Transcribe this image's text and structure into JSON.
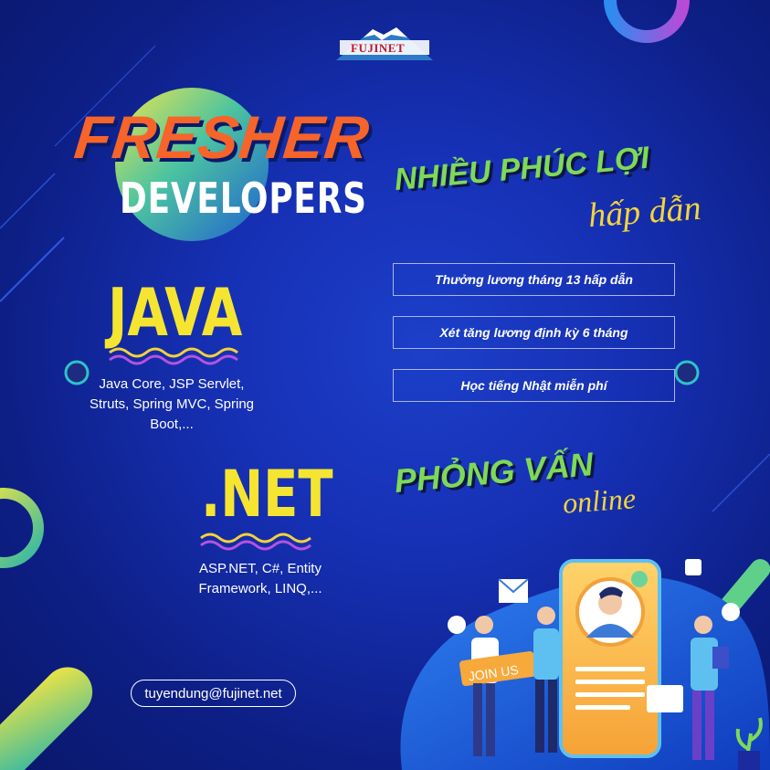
{
  "logo": {
    "text": "FUJINET"
  },
  "headline": {
    "line1": "FRESHER",
    "line2": "DEVELOPERS"
  },
  "java": {
    "title": "JAVA",
    "description": "Java Core, JSP Servlet, Struts, Spring MVC, Spring Boot,..."
  },
  "dotnet": {
    "title": ".NET",
    "description": "ASP.NET, C#, Entity Framework, LINQ,..."
  },
  "benefits": {
    "heading": "NHIỀU PHÚC LỢI",
    "subheading": "hấp dẫn",
    "items": [
      "Thưởng lương tháng 13 hấp dẫn",
      "Xét  tăng lương định kỳ 6 tháng",
      "Học tiếng Nhật miễn phí"
    ]
  },
  "interview": {
    "heading": "PHỎNG VẤN",
    "subheading": "online"
  },
  "illustration": {
    "sign": "JOIN US"
  },
  "contact": {
    "email": "tuyendung@fujinet.net"
  },
  "colors": {
    "background": "#1630b4",
    "accent_orange": "#f6642a",
    "accent_yellow": "#f5e531",
    "accent_green": "#7ed957"
  }
}
